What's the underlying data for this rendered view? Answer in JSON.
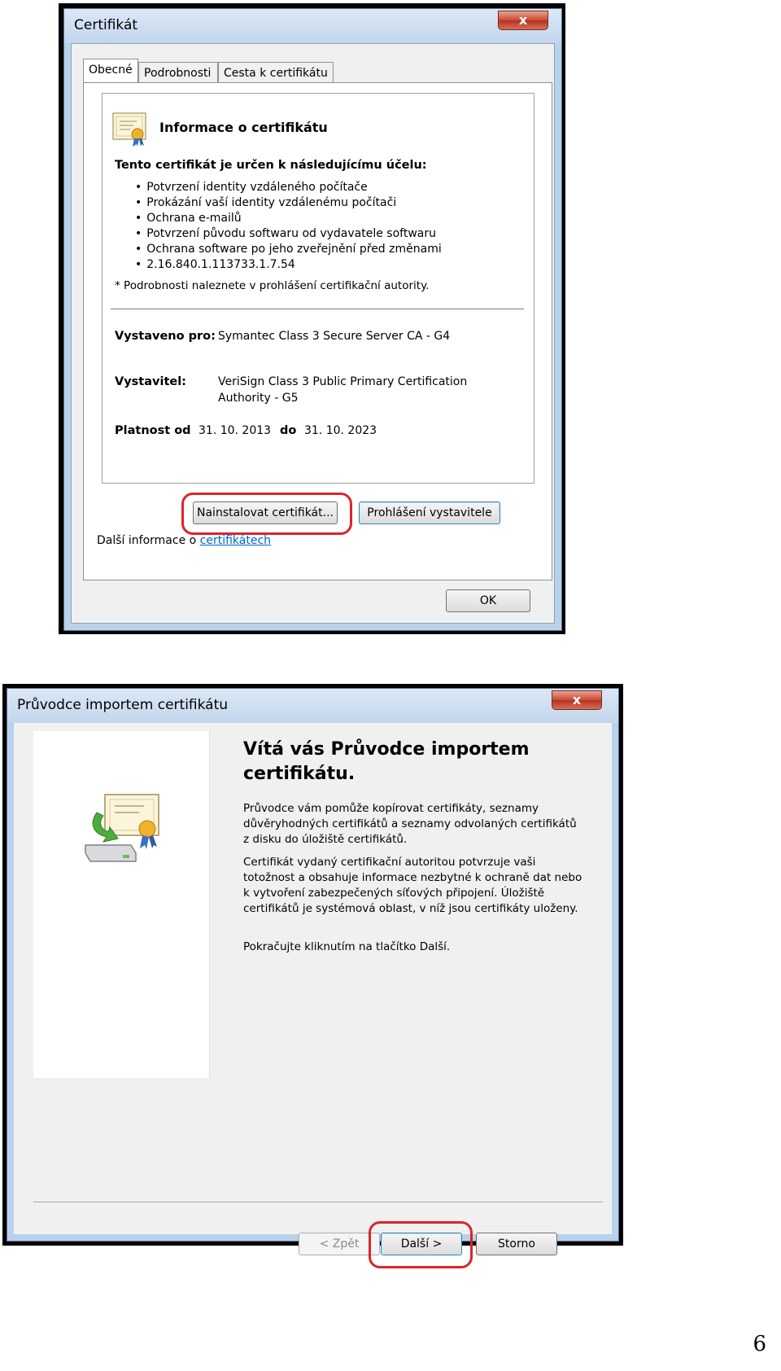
{
  "cert_dialog": {
    "title": "Certifikát",
    "close_label": "x",
    "tabs": [
      "Obecné",
      "Podrobnosti",
      "Cesta k certifikátu"
    ],
    "info_heading": "Informace o certifikátu",
    "purpose_heading": "Tento certifikát je určen k následujícímu účelu:",
    "purposes": [
      "Potvrzení identity vzdáleného počítače",
      "Prokázání vaší identity vzdálenému počítači",
      "Ochrana e-mailů",
      "Potvrzení původu softwaru od vydavatele softwaru",
      "Ochrana software po jeho zveřejnění před změnami",
      "2.16.840.1.113733.1.7.54"
    ],
    "note": "* Podrobnosti naleznete v prohlášení certifikační autority.",
    "issued_to_label": "Vystaveno pro:",
    "issued_to_value": "Symantec Class 3 Secure Server CA - G4",
    "issuer_label": "Vystavitel:",
    "issuer_value_line1": "VeriSign Class 3 Public Primary Certification",
    "issuer_value_line2": "Authority - G5",
    "valid_from_label": "Platnost od",
    "valid_from_value": "31. 10. 2013",
    "valid_to_label": "do",
    "valid_to_value": "31. 10. 2023",
    "install_button": "Nainstalovat certifikát...",
    "statement_button": "Prohlášení vystavitele",
    "more_info_prefix": "Další informace o ",
    "more_info_link": "certifikátech",
    "ok_button": "OK"
  },
  "wizard_dialog": {
    "title": "Průvodce importem certifikátu",
    "close_label": "x",
    "heading_line1": "Vítá vás Průvodce importem",
    "heading_line2": "certifikátu.",
    "para1": "Průvodce vám pomůže kopírovat certifikáty, seznamy důvěryhodných certifikátů a seznamy odvolaných certifikátů z disku do úložiště certifikátů.",
    "para2": "Certifikát vydaný certifikační autoritou potvrzuje vaši totožnost a obsahuje informace nezbytné k ochraně dat nebo k vytvoření zabezpečených síťových připojení. Úložiště certifikátů je systémová oblast, v níž jsou certifikáty uloženy.",
    "para3": "Pokračujte kliknutím na tlačítko Další.",
    "back_button": "< Zpět",
    "next_button": "Další >",
    "cancel_button": "Storno"
  },
  "page_number": "6",
  "colors": {
    "highlight_oval": "#d9262d",
    "link": "#0066cc",
    "window_frame": "#b9d1ea"
  }
}
